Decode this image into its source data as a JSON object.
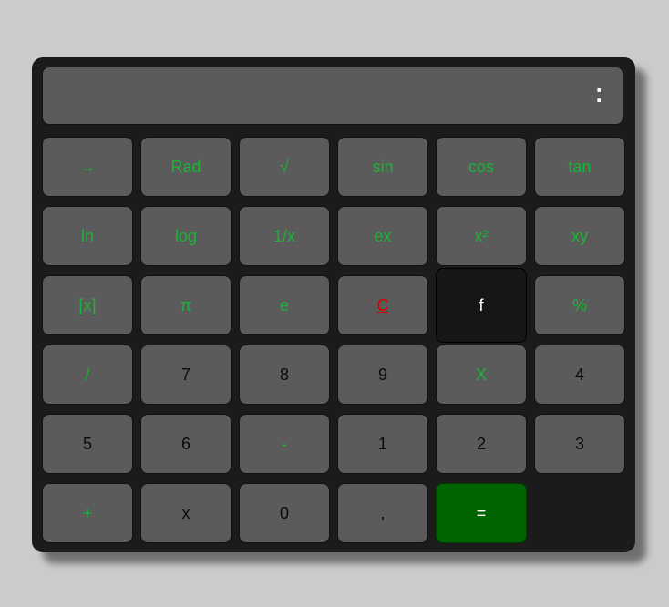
{
  "display": {
    "value": "",
    "menu_icon": "⁚"
  },
  "keys": {
    "r1": [
      "→",
      "Rad",
      "√",
      "sin",
      "cos",
      "tan"
    ],
    "r2": [
      "ln",
      "log",
      "1/x",
      "ex",
      "x²",
      "xy"
    ],
    "r3": [
      "[x]",
      "π",
      "e",
      "C",
      "f",
      "%"
    ],
    "r4": [
      "/",
      "7",
      "8",
      "9",
      "X",
      "4"
    ],
    "r5": [
      "5",
      "6",
      "-",
      "1",
      "2",
      "3"
    ],
    "r6": [
      "+",
      "x",
      "0",
      ",",
      "="
    ]
  },
  "colors": {
    "function_text": "#1bb437",
    "number_text": "#0a0a0a",
    "clear_text": "#d40000",
    "equals_bg": "#006400",
    "key_bg": "#5b5b5b",
    "body_bg": "#1b1b1b"
  }
}
